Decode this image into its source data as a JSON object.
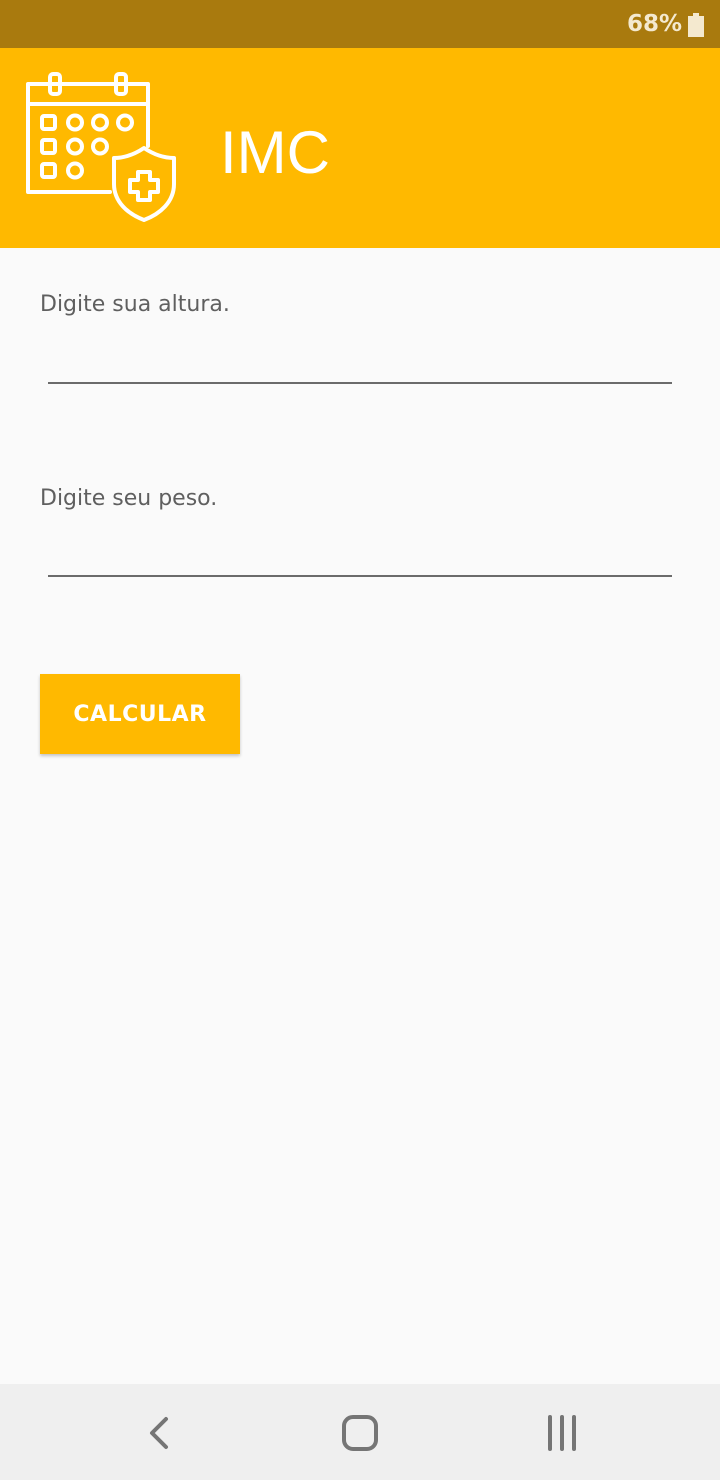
{
  "status_bar": {
    "battery_text": "68%",
    "battery_icon": "battery-icon"
  },
  "app_bar": {
    "title": "IMC",
    "logo_icon": "calendar-shield-plus-icon",
    "background_color": "#ffb900"
  },
  "form": {
    "height_label": "Digite sua altura.",
    "height_value": "",
    "weight_label": "Digite seu peso.",
    "weight_value": "",
    "calculate_button_label": "CALCULAR"
  },
  "nav_bar": {
    "back_icon": "chevron-left-icon",
    "home_icon": "home-icon",
    "recents_icon": "recent-apps-icon"
  },
  "colors": {
    "accent": "#ffb900",
    "status_bar": "#a97a0e"
  }
}
